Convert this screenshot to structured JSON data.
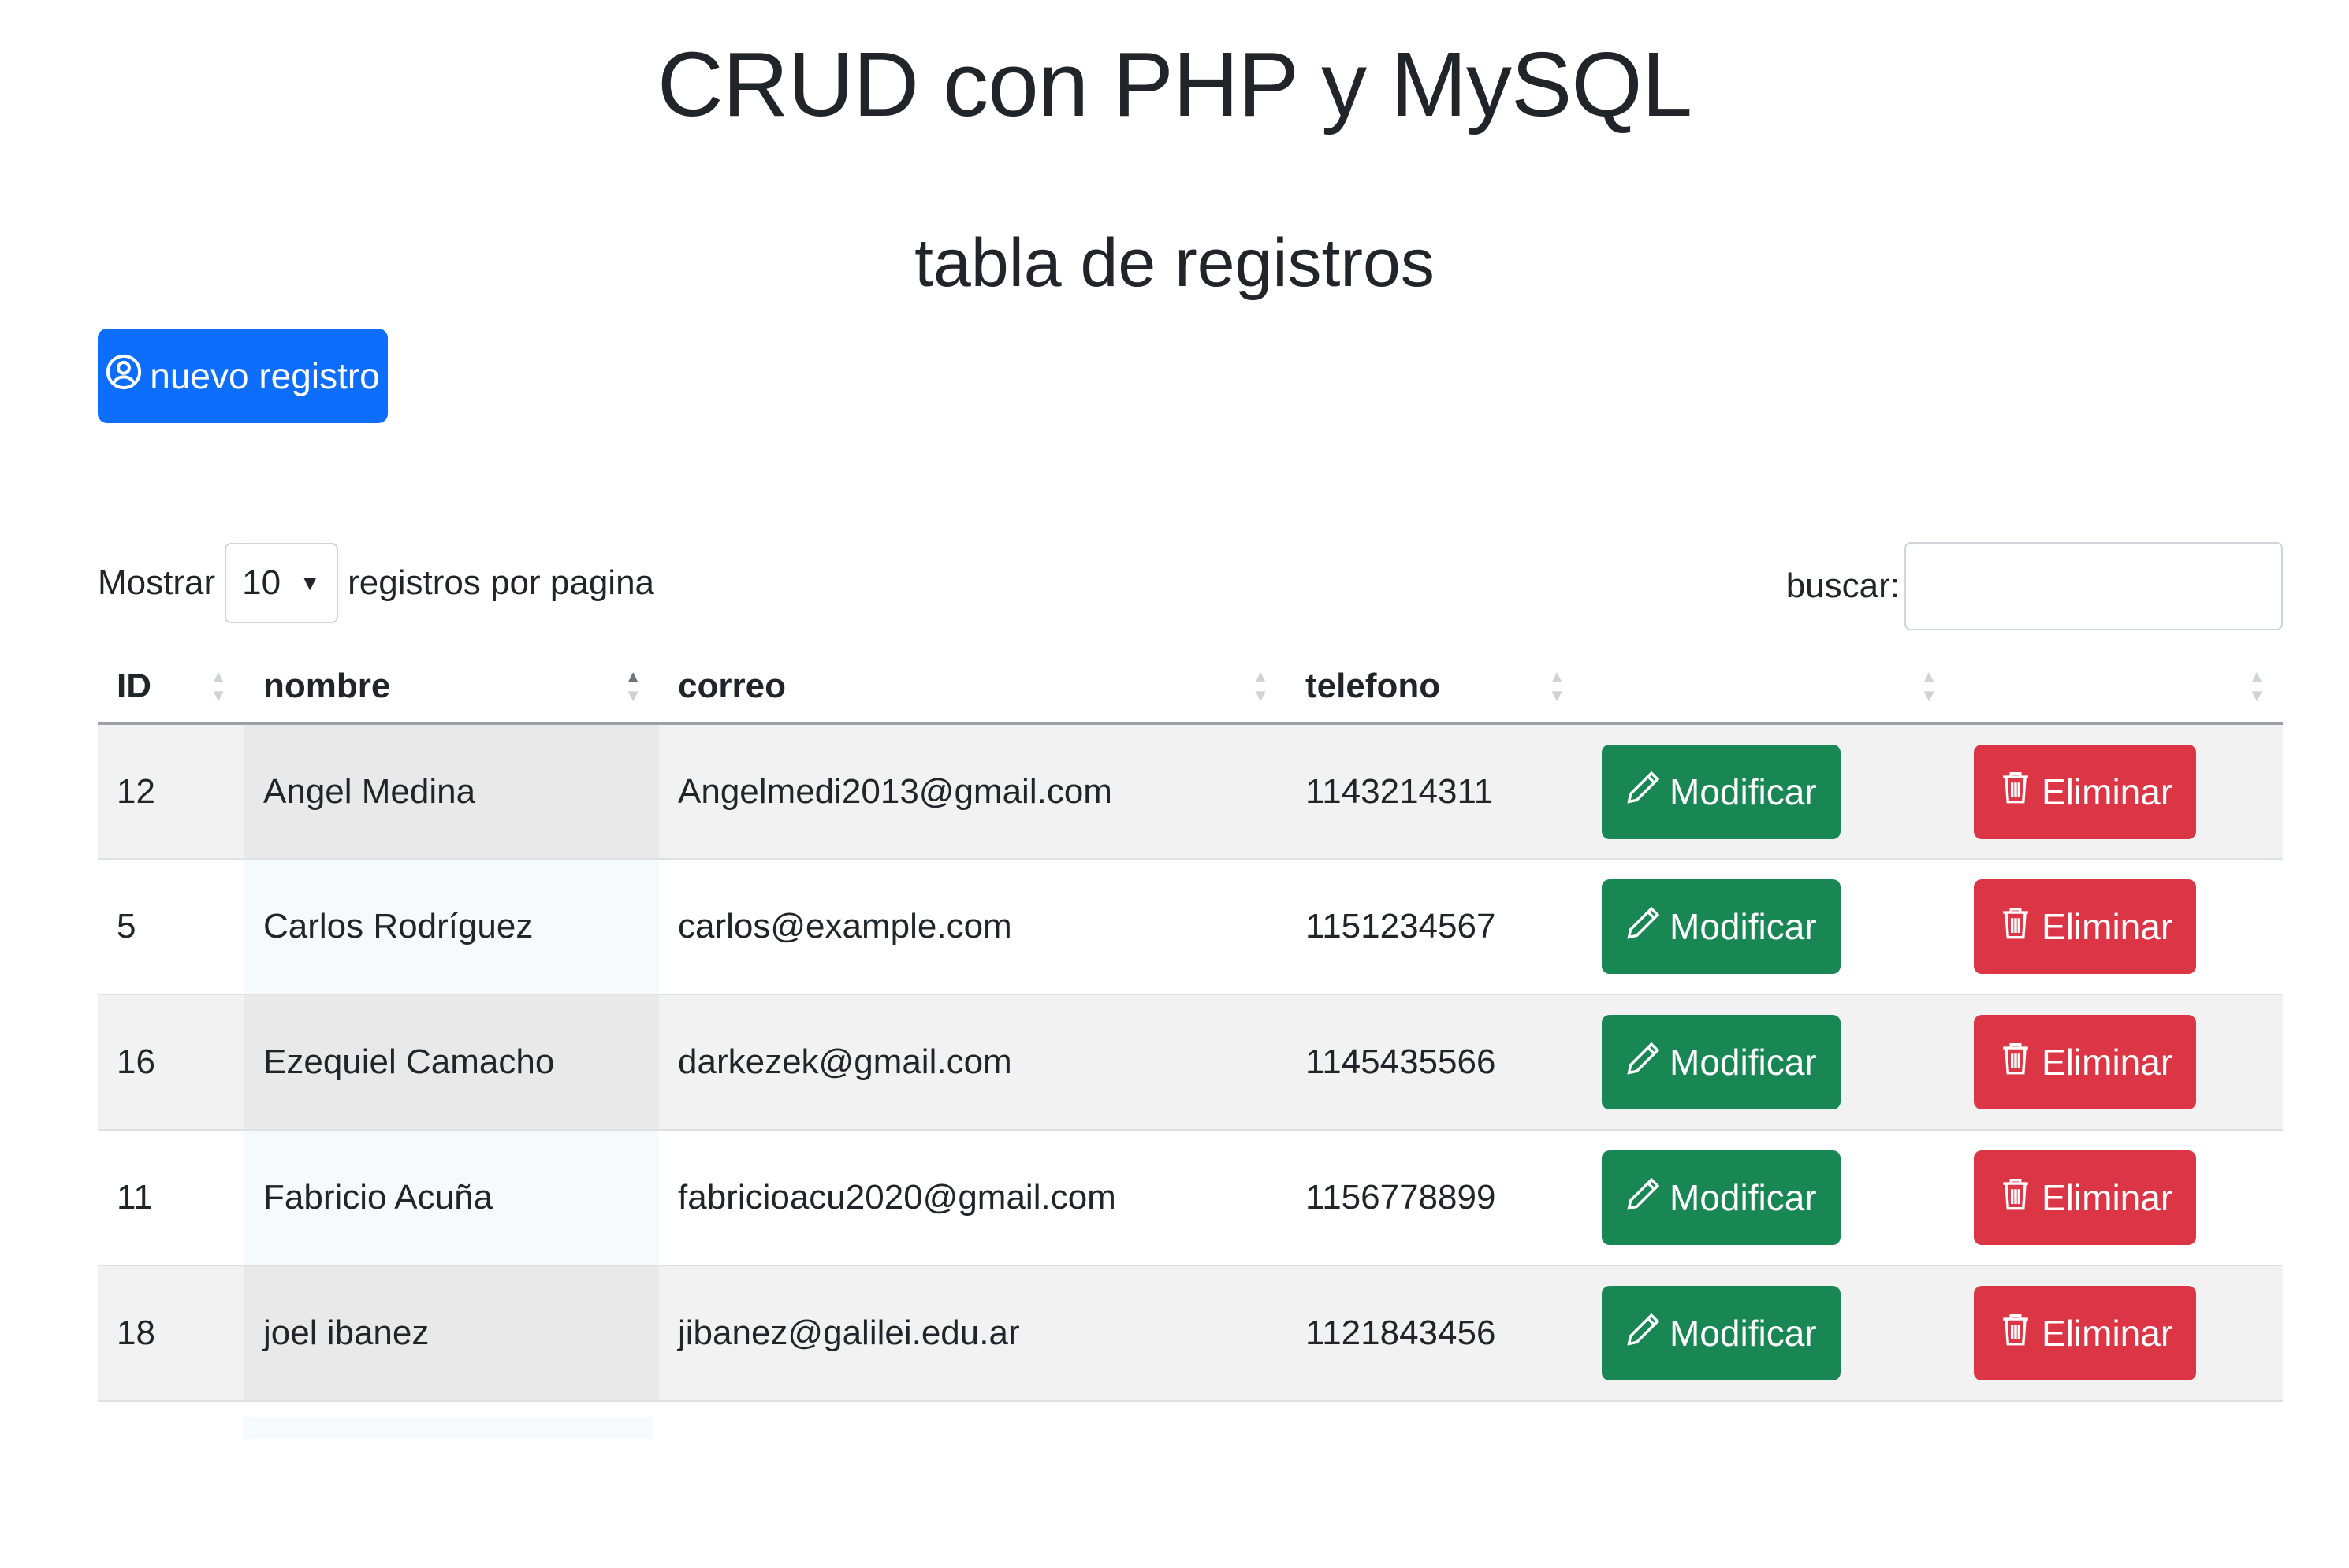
{
  "header": {
    "title": "CRUD con PHP y MySQL",
    "subtitle": "tabla de registros"
  },
  "toolbar": {
    "new_label": "nuevo registro"
  },
  "length_control": {
    "prefix": "Mostrar",
    "selected": "10",
    "suffix": "registros por pagina"
  },
  "search": {
    "label": "buscar:",
    "value": ""
  },
  "table": {
    "columns": [
      "ID",
      "nombre",
      "correo",
      "telefono",
      "",
      ""
    ],
    "rows": [
      {
        "id": "12",
        "nombre": "Angel Medina",
        "correo": "Angelmedi2013@gmail.com",
        "telefono": "1143214311",
        "edit": "Modificar",
        "delete": "Eliminar"
      },
      {
        "id": "5",
        "nombre": "Carlos Rodríguez",
        "correo": "carlos@example.com",
        "telefono": "1151234567",
        "edit": "Modificar",
        "delete": "Eliminar"
      },
      {
        "id": "16",
        "nombre": "Ezequiel Camacho",
        "correo": "darkezek@gmail.com",
        "telefono": "1145435566",
        "edit": "Modificar",
        "delete": "Eliminar"
      },
      {
        "id": "11",
        "nombre": "Fabricio Acuña",
        "correo": "fabricioacu2020@gmail.com",
        "telefono": "1156778899",
        "edit": "Modificar",
        "delete": "Eliminar"
      },
      {
        "id": "18",
        "nombre": "joel ibanez",
        "correo": "jibanez@galilei.edu.ar",
        "telefono": "1121843456",
        "edit": "Modificar",
        "delete": "Eliminar"
      }
    ]
  },
  "icons": {
    "new": "user-circle-icon",
    "edit": "pencil-icon",
    "delete": "trash-icon",
    "sort_asc": "sort-ascending-icon",
    "sort_both": "sort-both-icon"
  },
  "colors": {
    "primary": "#0d6efd",
    "success": "#198754",
    "danger": "#dc3545"
  }
}
